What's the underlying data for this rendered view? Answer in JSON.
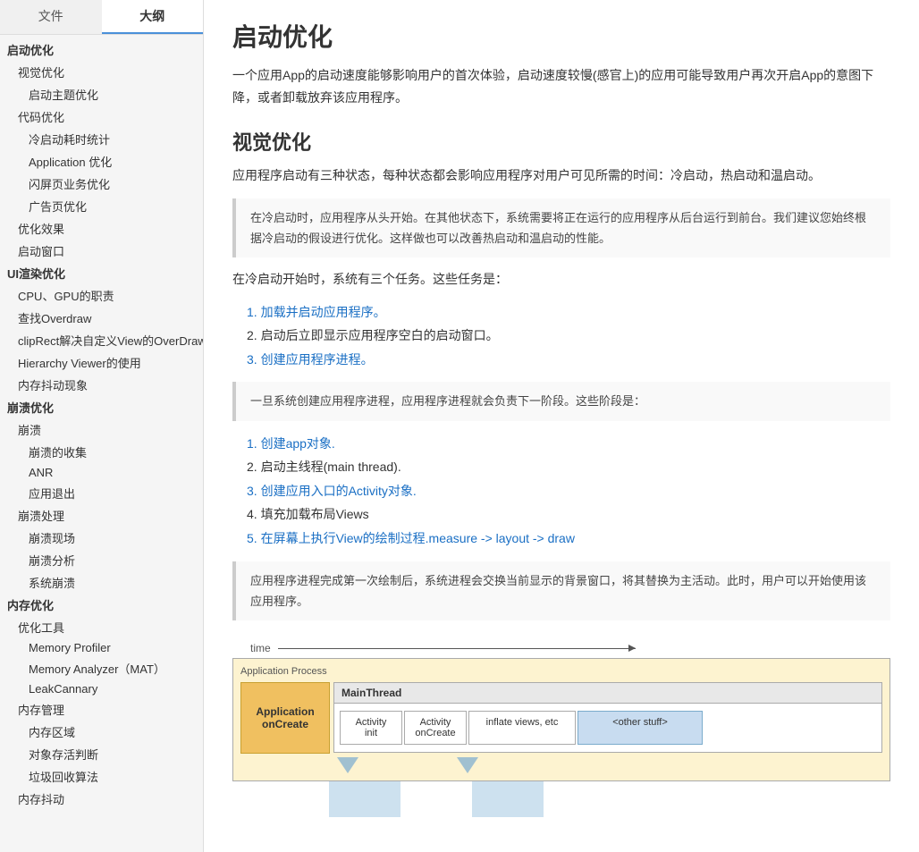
{
  "sidebar": {
    "tabs": [
      {
        "id": "file",
        "label": "文件"
      },
      {
        "id": "outline",
        "label": "大纲",
        "active": true
      }
    ],
    "items": [
      {
        "id": "startup-opt",
        "label": "启动优化",
        "level": 0
      },
      {
        "id": "visual-opt",
        "label": "视觉优化",
        "level": 1
      },
      {
        "id": "splash-theme-opt",
        "label": "启动主题优化",
        "level": 2
      },
      {
        "id": "code-opt",
        "label": "代码优化",
        "level": 1
      },
      {
        "id": "cold-start-time",
        "label": "冷启动耗时统计",
        "level": 2
      },
      {
        "id": "application-opt",
        "label": "Application 优化",
        "level": 2
      },
      {
        "id": "flash-page-opt",
        "label": "闪屏页业务优化",
        "level": 2
      },
      {
        "id": "ad-page-opt",
        "label": "广告页优化",
        "level": 2
      },
      {
        "id": "opt-effect",
        "label": "优化效果",
        "level": 1
      },
      {
        "id": "startup-window",
        "label": "启动窗口",
        "level": 1
      },
      {
        "id": "ui-render-opt",
        "label": "UI渲染优化",
        "level": 0
      },
      {
        "id": "cpu-gpu-role",
        "label": "CPU、GPU的职责",
        "level": 1
      },
      {
        "id": "find-overdraw",
        "label": "查找Overdraw",
        "level": 1
      },
      {
        "id": "cliprect-customview",
        "label": "clipRect解决自定义View的OverDraw",
        "level": 1
      },
      {
        "id": "hierarchy-viewer",
        "label": "Hierarchy Viewer的使用",
        "level": 1
      },
      {
        "id": "memory-jitter",
        "label": "内存抖动现象",
        "level": 1
      },
      {
        "id": "crash-opt",
        "label": "崩溃优化",
        "level": 0
      },
      {
        "id": "crash",
        "label": "崩溃",
        "level": 1
      },
      {
        "id": "crash-collect",
        "label": "崩溃的收集",
        "level": 2
      },
      {
        "id": "anr",
        "label": "ANR",
        "level": 2
      },
      {
        "id": "app-exit",
        "label": "应用退出",
        "level": 2
      },
      {
        "id": "crash-handle",
        "label": "崩溃处理",
        "level": 1
      },
      {
        "id": "crash-scene",
        "label": "崩溃现场",
        "level": 2
      },
      {
        "id": "crash-analysis",
        "label": "崩溃分析",
        "level": 2
      },
      {
        "id": "system-crash",
        "label": "系统崩溃",
        "level": 2
      },
      {
        "id": "memory-opt",
        "label": "内存优化",
        "level": 0
      },
      {
        "id": "opt-tools",
        "label": "优化工具",
        "level": 1
      },
      {
        "id": "memory-profiler",
        "label": "Memory Profiler",
        "level": 2
      },
      {
        "id": "memory-analyzer",
        "label": "Memory Analyzer（MAT）",
        "level": 2
      },
      {
        "id": "leakcannary",
        "label": "LeakCannary",
        "level": 2
      },
      {
        "id": "memory-manage",
        "label": "内存管理",
        "level": 1
      },
      {
        "id": "memory-region",
        "label": "内存区域",
        "level": 2
      },
      {
        "id": "object-survival",
        "label": "对象存活判断",
        "level": 2
      },
      {
        "id": "gc-method",
        "label": "垃圾回收算法",
        "level": 2
      },
      {
        "id": "memory-jitter2",
        "label": "内存抖动",
        "level": 1
      }
    ]
  },
  "main": {
    "title": "启动优化",
    "intro": "一个应用App的启动速度能够影响用户的首次体验，启动速度较慢(感官上)的应用可能导致用户再次开启App的意图下降，或者卸载放弃该应用程序。",
    "section1_title": "视觉优化",
    "section1_para": "应用程序启动有三种状态，每种状态都会影响应用程序对用户可见所需的时间：冷启动，热启动和温启动。",
    "blockquote1": "在冷启动时，应用程序从头开始。在其他状态下，系统需要将正在运行的应用程序从后台运行到前台。我们建议您始终根据冷启动的假设进行优化。这样做也可以改善热启动和温启动的性能。",
    "section1_intro2": "在冷启动开始时，系统有三个任务。这些任务是：",
    "tasks": [
      {
        "num": "1.",
        "text": "加载并启动应用程序。",
        "blue": true
      },
      {
        "num": "2.",
        "text": "启动后立即显示应用程序空白的启动窗口。",
        "blue": false
      },
      {
        "num": "3.",
        "text": "创建应用程序进程。",
        "blue": true
      }
    ],
    "blockquote2": "一旦系统创建应用程序进程，应用程序进程就会负责下一阶段。这些阶段是：",
    "phases": [
      {
        "num": "1.",
        "text": "创建app对象.",
        "blue": true
      },
      {
        "num": "2.",
        "text": "启动主线程(main thread).",
        "blue": false
      },
      {
        "num": "3.",
        "text": "创建应用入口的Activity对象.",
        "blue": true
      },
      {
        "num": "4.",
        "text": "填充加载布局Views",
        "blue": false
      },
      {
        "num": "5.",
        "text": "在屏幕上执行View的绘制过程.measure -> layout -> draw",
        "blue": true
      }
    ],
    "blockquote3": "应用程序进程完成第一次绘制后，系统进程会交换当前显示的背景窗口，将其替换为主活动。此时，用户可以开始使用该应用程序。",
    "diagram": {
      "time_label": "time",
      "app_process_label": "Application Process",
      "main_thread_label": "MainThread",
      "app_oncreate_label": "Application\nonCreate",
      "blocks": [
        {
          "id": "activity-init",
          "label": "Activity\ninit",
          "type": "normal"
        },
        {
          "id": "activity-oncreate",
          "label": "Activity\nonCreate",
          "type": "normal"
        },
        {
          "id": "inflate-views",
          "label": "inflate views, etc",
          "type": "wide"
        },
        {
          "id": "other-stuff",
          "label": "<other stuff>",
          "type": "blue"
        }
      ]
    }
  },
  "colors": {
    "accent": "#4a90d9",
    "link": "#1a6fc4",
    "blockquote_border": "#ccc",
    "sidebar_active_border": "#4a90d9",
    "diagram_orange": "#f0c060",
    "diagram_blue": "#c8dcf0"
  }
}
